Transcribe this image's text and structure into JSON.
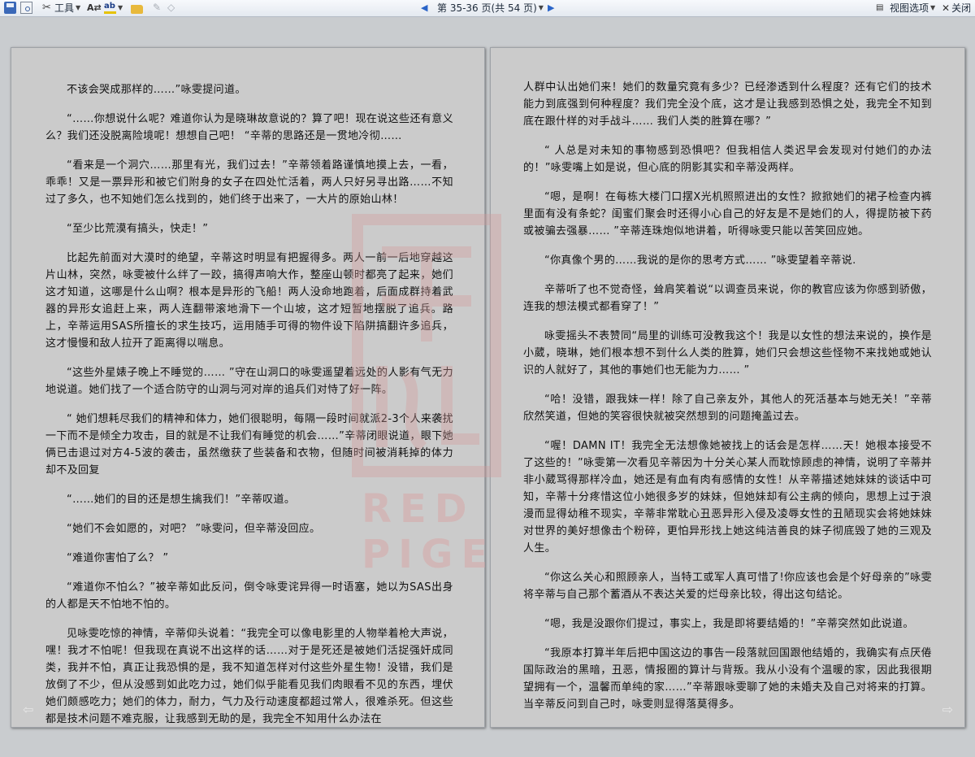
{
  "toolbar": {
    "tools_label": "工具",
    "page_info": "第 35-36 页(共 54 页)",
    "view_options_label": "视图选项",
    "close_label": "关闭"
  },
  "watermark": {
    "text": "RED PIGE"
  },
  "left_page": {
    "paragraphs": [
      "不该会哭成那样的……”咏雯提问道。",
      "“……你想说什么呢？难道你认为是晓琳故意说的？算了吧！现在说这些还有意义么？我们还没脱离险境呢！想想自己吧！ “辛蒂的思路还是一贯地冷彻……",
      "“看来是一个洞穴……那里有光，我们过去！”辛蒂领着路谨慎地摸上去，一看，乖乖！又是一票异形和被它们附身的女子在四处忙活着，两人只好另寻出路……不知过了多久，也不知她们怎么找到的，她们终于出来了，一大片的原始山林！",
      "“至少比荒漠有搞头，快走！”",
      "比起先前面对大漠时的绝望，辛蒂这时明显有把握得多。两人一前一后地穿越这片山林，突然，咏雯被什么绊了一跤，搞得声响大作，整座山顿时都亮了起来，她们这才知道，这哪是什么山啊？根本是异形的飞船！两人没命地跑着，后面成群持着武器的异形女追赶上来，两人连翻带滚地滑下一个山坡，这才短暂地摆脱了追兵。路上，辛蒂运用SAS所擅长的求生技巧，运用随手可得的物件设下陷阱搞翻许多追兵，这才慢慢和敌人拉开了距离得以喘息。",
      "“这些外星婊子晚上不睡觉的…… ”守在山洞口的咏雯遥望着远处的人影有气无力地说道。她们找了一个适合防守的山洞与河对岸的追兵们对恃了好一阵。",
      "“ 她们想耗尽我们的精神和体力，她们很聪明，每隔一段时间就派2-3个人来袭扰一下而不是倾全力攻击，目的就是不让我们有睡觉的机会……”辛蒂闭眼说道，眼下她俩已击退过对方4-5波的袭击，虽然缴获了些装备和衣物，但随时间被消耗掉的体力却不及回复",
      "“……她们的目的还是想生擒我们！”辛蒂叹道。",
      "“她们不会如愿的，对吧？ ”咏雯问，但辛蒂没回应。",
      "“难道你害怕了么？ ”",
      "“难道你不怕么？”被辛蒂如此反问，倒令咏雯诧异得一时语塞，她以为SAS出身的人都是天不怕地不怕的。",
      "见咏雯吃惊的神情，辛蒂仰头说着：“我完全可以像电影里的人物举着枪大声说，嘿！我才不怕呢！但我现在真说不出这样的话……对于是死还是被她们活捉强奸成同类，我并不怕，真正让我恐惧的是，我不知道怎样对付这些外星生物！没错，我们是放倒了不少，但从没感到如此吃力过，她们似乎能看见我们肉眼看不见的东西，埋伏她们颇感吃力；她们的体力，耐力，气力及行动速度都超过常人，很难杀死。但这些都是技术问题不难克服，让我感到无助的是，我完全不知用什么办法在"
    ]
  },
  "right_page": {
    "continuation": "人群中认出她们来！她们的数量究竟有多少？已经渗透到什么程度？还有它们的技术能力到底强到何种程度？我们完全没个底，这才是让我感到恐惧之处，我完全不知到底在跟什样的对手战斗…… 我们人类的胜算在哪？”",
    "paragraphs": [
      "“ 人总是对未知的事物感到恐惧吧？但我相信人类迟早会发现对付她们的办法的！”咏雯嘴上如是说，但心底的阴影其实和辛蒂没两样。",
      "“嗯，是啊！在每栋大楼门口摆X光机照照进出的女性？掀掀她们的裙子检查内裤里面有没有条蛇？闺蜜们聚会时还得小心自己的好友是不是她们的人，得提防被下药或被骗去强暴…… ”辛蒂连珠炮似地讲着，听得咏雯只能以苦笑回应她。",
      "“你真像个男的……我说的是你的思考方式…… ”咏雯望着辛蒂说.",
      "辛蒂听了也不觉奇怪，耸肩笑着说“以调查员来说，你的教官应该为你感到骄傲，连我的想法模式都看穿了！”",
      "咏雯摇头不表赞同“局里的训练可没教我这个！我是以女性的想法来说的，换作是小葳，晓琳，她们根本想不到什么人类的胜算，她们只会想这些怪物不来找她或她认识的人就好了，其他的事她们也无能为力…… ”",
      "“哈！没错，跟我妹一样！除了自己亲友外，其他人的死活基本与她无关！”辛蒂欣然笑道，但她的笑容很快就被突然想到的问题掩盖过去。",
      "“喔！DAMN IT！我完全无法想像她被找上的话会是怎样……天！她根本接受不了这些的！”咏雯第一次看见辛蒂因为十分关心某人而耽惊顾虑的神情，说明了辛蒂并非小葳骂得那样冷血，她还是有血有肉有感情的女性！从辛蒂描述她妹妹的谈话中可知，辛蒂十分疼惜这位小她很多岁的妹妹，但她妹却有公主病的倾向，思想上过于浪漫而显得幼稚不现实，辛蒂非常耽心丑恶异形入侵及凌辱女性的丑陋现实会将她妹妹对世界的美好想像击个粉碎，更怕异形找上她这纯洁善良的妹子彻底毁了她的三观及人生。",
      "“你这么关心和照顾亲人，当特工或军人真可惜了!你应该也会是个好母亲的”咏雯将辛蒂与自己那个蓄酒从不表达关爱的烂母亲比较，得出这句结论。",
      "“嗯，我是没跟你们提过，事实上，我是即将要结婚的！”辛蒂突然如此说道。",
      "“我原本打算半年后把中国这边的事告一段落就回国跟他结婚的，我确实有点厌倦国际政治的黑暗，丑恶，情报圈的算计与背叛。我从小没有个温暖的家，因此我很期望拥有一个，温馨而单纯的家……”辛蒂跟咏雯聊了她的未婚夫及自己对将来的打算。当辛蒂反问到自己时，咏雯则显得落莫得多。"
    ]
  }
}
